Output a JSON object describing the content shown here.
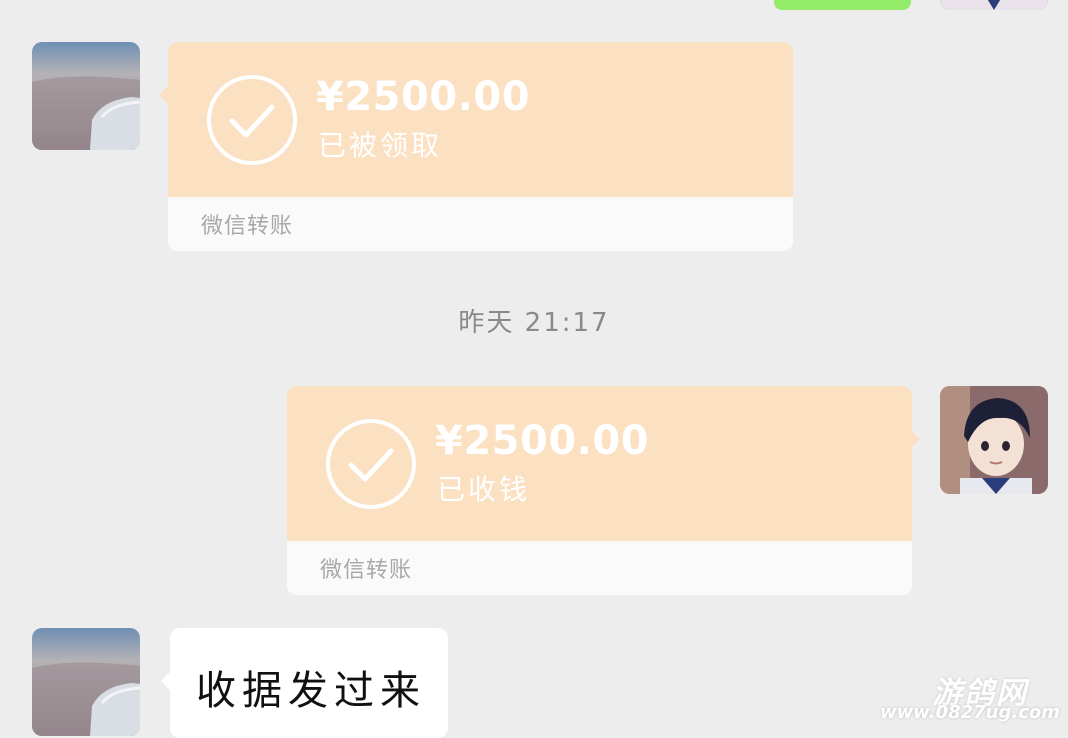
{
  "messages": [
    {
      "type": "transfer",
      "side": "left",
      "amount": "¥2500.00",
      "status": "已被领取",
      "footer": "微信转账"
    },
    {
      "type": "timestamp",
      "text": "昨天 21:17"
    },
    {
      "type": "transfer",
      "side": "right",
      "amount": "¥2500.00",
      "status": "已收钱",
      "footer": "微信转账"
    },
    {
      "type": "text",
      "side": "left",
      "text": "收据发过来"
    }
  ],
  "watermark": {
    "title": "游鸽网",
    "url": "www.0827ug.com"
  },
  "colors": {
    "background": "#ededed",
    "transfer_card": "#fbe0c2",
    "sent_bubble": "#95ec69"
  },
  "icons": {
    "check": "check-circle-icon"
  }
}
